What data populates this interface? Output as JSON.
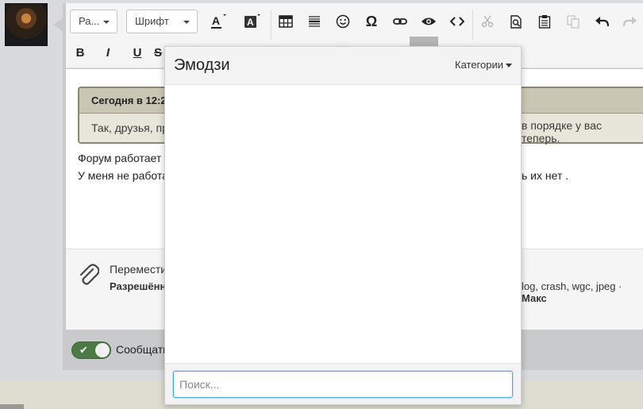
{
  "toolbar": {
    "paragraph_label": "Ра...",
    "font_label": "Шрифт",
    "buttons": [
      "table",
      "hr",
      "emoji",
      "special-chars",
      "link",
      "preview",
      "source",
      "cut",
      "find",
      "paste",
      "copy",
      "undo",
      "redo"
    ],
    "format": {
      "bold": "B",
      "italic": "I",
      "underline": "U"
    }
  },
  "quote": {
    "header": "Сегодня в 12:2",
    "body_left": "Так, друзья, пр",
    "body_right": "в порядке у вас теперь."
  },
  "message": {
    "line1": "Форум работает",
    "line2_left": "У меня не работа",
    "line2_right": "ь их нет ."
  },
  "attachments": {
    "drag_text": "Перемести",
    "allowed_label": "Разрешённ",
    "allowed_right": "log, crash, wgc, jpeg · ",
    "max_label": "Макс"
  },
  "footer": {
    "toggle_label": "Сообщать",
    "toggle_on": true
  },
  "emoji_popup": {
    "title": "Эмодзи",
    "categories_label": "Категории",
    "search_placeholder": "Поиск..."
  }
}
